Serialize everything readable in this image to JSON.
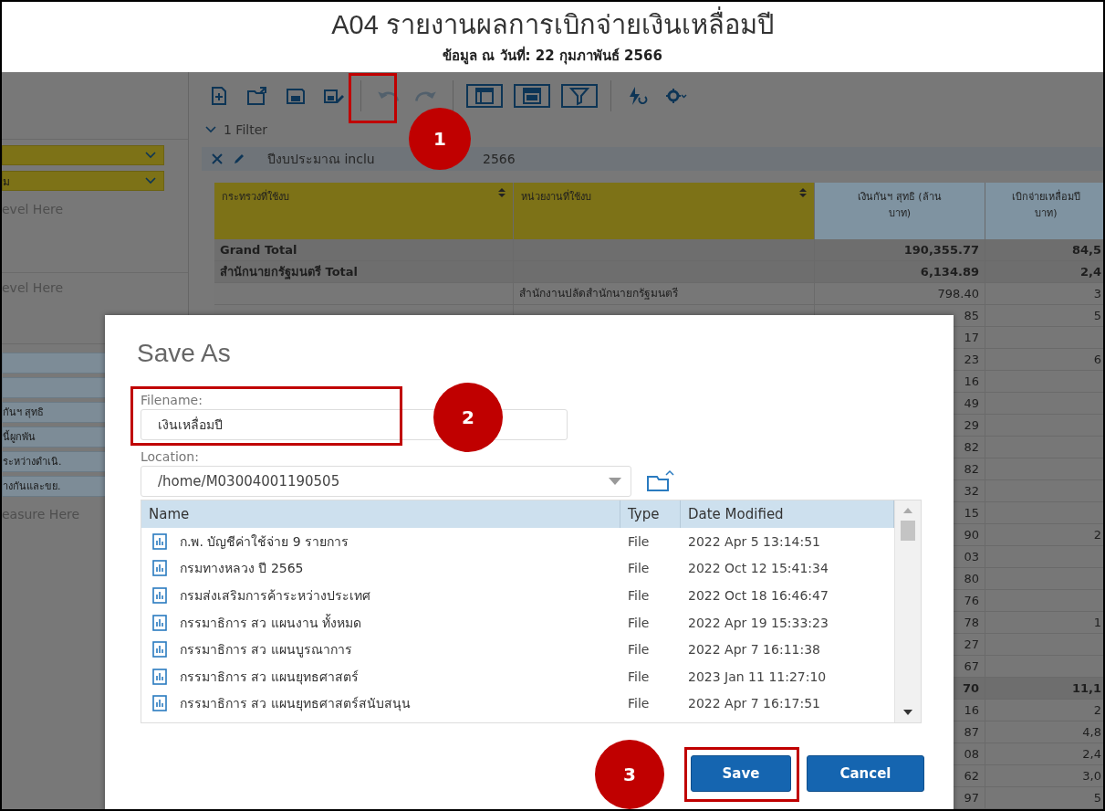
{
  "report": {
    "title": "A04 รายงานผลการเบิกจ่ายเงินเหลื่อมปี",
    "subtitle": "ข้อมูล ณ วันที่: 22 กุมภาพันธ์ 2566"
  },
  "left_panel": {
    "row_fields": [
      {
        "kind": "blank"
      },
      {
        "kind": "labeled",
        "text": "ม"
      }
    ],
    "row_hint": "evel Here",
    "column_hint": "evel Here",
    "measures": [
      {
        "kind": "blank"
      },
      {
        "kind": "blank"
      },
      {
        "kind": "labeled",
        "text": "กันฯ สุทธิ"
      },
      {
        "kind": "labeled",
        "text": "นี้ผูกพัน"
      },
      {
        "kind": "labeled",
        "text": "ระหว่างดำเนิ."
      },
      {
        "kind": "labeled",
        "text": "างกันและขย."
      }
    ],
    "measure_hint": "easure Here"
  },
  "toolbar": {
    "groups": [
      [
        {
          "kind": "new",
          "disabled": false
        },
        {
          "kind": "open",
          "disabled": false
        },
        {
          "kind": "save",
          "disabled": false
        },
        {
          "kind": "save_as",
          "disabled": false
        }
      ],
      [
        {
          "kind": "undo",
          "disabled": true
        },
        {
          "kind": "redo",
          "disabled": true
        }
      ],
      [
        {
          "kind": "layout",
          "disabled": false
        },
        {
          "kind": "table",
          "disabled": false
        },
        {
          "kind": "filter",
          "disabled": false
        }
      ],
      [
        {
          "kind": "refresh",
          "disabled": false
        },
        {
          "kind": "settings",
          "disabled": false
        }
      ]
    ]
  },
  "filter": {
    "count_label": "1 Filter",
    "expanded": true,
    "text_before": "ปีงบประมาณ inclu",
    "text_after": "2566"
  },
  "table": {
    "columns": [
      {
        "lines": [
          "กระทรวงที่ใช้งบ"
        ],
        "kind": "dimension",
        "sortable": true
      },
      {
        "lines": [
          "หน่วยงานที่ใช้งบ"
        ],
        "kind": "dimension",
        "sortable": true
      },
      {
        "lines": [
          "เงินกันฯ สุทธิ (ล้าน",
          "บาท)"
        ],
        "kind": "measure",
        "sortable": false
      },
      {
        "lines": [
          "เบิกจ่ายเหลื่อมปี",
          "บาท)"
        ],
        "kind": "measure",
        "sortable": false
      }
    ],
    "rows": [
      {
        "kind": "total",
        "ministry": "Grand Total",
        "reserve": "190,355.77",
        "disbursed": "84,5"
      },
      {
        "kind": "total",
        "ministry": "สำนักนายกรัฐมนตรี Total",
        "reserve": "6,134.89",
        "disbursed": "2,4"
      },
      {
        "kind": "detail",
        "agency": "สำนักงานปลัดสำนักนายกรัฐมนตรี",
        "reserve": "798.40",
        "disbursed": "3"
      },
      {
        "kind": "detail",
        "reserve": "85",
        "disbursed": "5"
      },
      {
        "kind": "detail",
        "reserve": "17"
      },
      {
        "kind": "detail",
        "reserve": "23",
        "disbursed": "6"
      },
      {
        "kind": "detail",
        "reserve": "16"
      },
      {
        "kind": "detail",
        "reserve": "49"
      },
      {
        "kind": "detail",
        "reserve": "29"
      },
      {
        "kind": "detail",
        "reserve": "82"
      },
      {
        "kind": "detail",
        "reserve": "82"
      },
      {
        "kind": "detail",
        "reserve": "32"
      },
      {
        "kind": "detail",
        "reserve": "15"
      },
      {
        "kind": "detail",
        "reserve": "90",
        "disbursed": "2"
      },
      {
        "kind": "detail",
        "reserve": "03"
      },
      {
        "kind": "detail",
        "reserve": "80"
      },
      {
        "kind": "detail",
        "reserve": "76"
      },
      {
        "kind": "detail",
        "reserve": "78",
        "disbursed": "1"
      },
      {
        "kind": "detail",
        "reserve": "27"
      },
      {
        "kind": "detail",
        "reserve": "67"
      },
      {
        "kind": "total",
        "reserve": "70",
        "disbursed": "11,1"
      },
      {
        "kind": "detail",
        "reserve": "16",
        "disbursed": "2"
      },
      {
        "kind": "detail",
        "reserve": "87",
        "disbursed": "4,8"
      },
      {
        "kind": "detail",
        "reserve": "08",
        "disbursed": "2,4"
      },
      {
        "kind": "detail",
        "reserve": "62",
        "disbursed": "3,0"
      },
      {
        "kind": "detail",
        "reserve": "97",
        "disbursed": "5"
      }
    ]
  },
  "dialog": {
    "title": "Save As",
    "filename": {
      "label": "Filename:",
      "value": "เงินเหลื่อมปี"
    },
    "location": {
      "label": "Location:",
      "value": "/home/M03004001190505"
    },
    "files": {
      "columns": [
        "Name",
        "Type",
        "Date Modified"
      ],
      "rows": [
        {
          "name": "ก.พ. บัญชีค่าใช้จ่าย 9 รายการ",
          "type": "File",
          "modified": "2022 Apr 5 13:14:51"
        },
        {
          "name": "กรมทางหลวง ปี 2565",
          "type": "File",
          "modified": "2022 Oct 12 15:41:34"
        },
        {
          "name": "กรมส่งเสริมการค้าระหว่างประเทศ",
          "type": "File",
          "modified": "2022 Oct 18 16:46:47"
        },
        {
          "name": "กรรมาธิการ สว แผนงาน ทั้งหมด",
          "type": "File",
          "modified": "2022 Apr 19 15:33:23"
        },
        {
          "name": "กรรมาธิการ สว แผนบูรณาการ",
          "type": "File",
          "modified": "2022 Apr 7 16:11:38"
        },
        {
          "name": "กรรมาธิการ สว แผนยุทธศาสตร์",
          "type": "File",
          "modified": "2023 Jan 11 11:27:10"
        },
        {
          "name": "กรรมาธิการ สว แผนยุทธศาสตร์สนับสนุน",
          "type": "File",
          "modified": "2022 Apr 7 16:17:51"
        }
      ]
    },
    "buttons": [
      {
        "label": "Save"
      },
      {
        "label": "Cancel"
      }
    ]
  },
  "annotations": [
    {
      "number": "1"
    },
    {
      "number": "2"
    },
    {
      "number": "3"
    }
  ]
}
